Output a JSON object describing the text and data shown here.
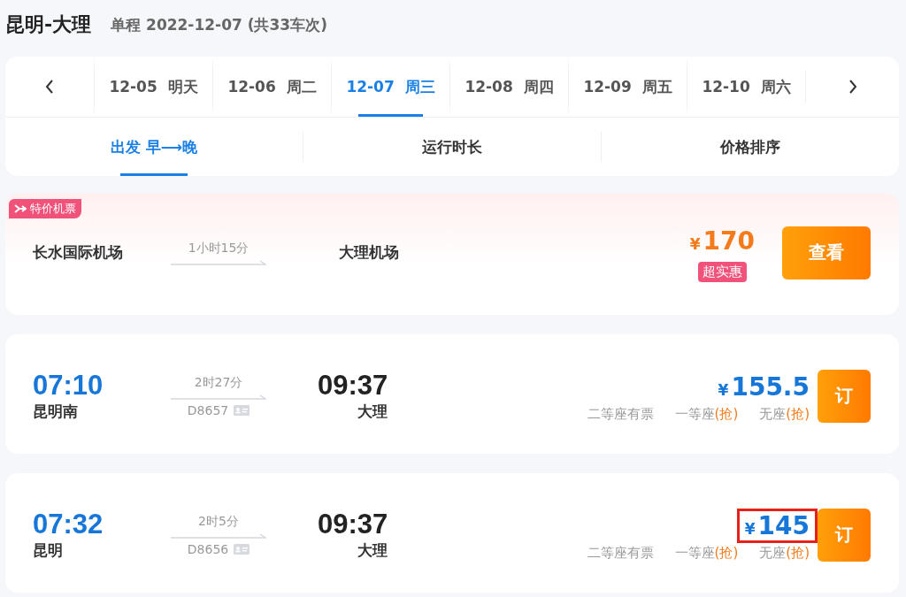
{
  "header": {
    "route": "昆明-大理",
    "summary": "单程 2022-12-07 (共33车次)"
  },
  "date_tabs": [
    {
      "date": "12-05",
      "day": "明天",
      "selected": false
    },
    {
      "date": "12-06",
      "day": "周二",
      "selected": false
    },
    {
      "date": "12-07",
      "day": "周三",
      "selected": true
    },
    {
      "date": "12-08",
      "day": "周四",
      "selected": false
    },
    {
      "date": "12-09",
      "day": "周五",
      "selected": false
    },
    {
      "date": "12-10",
      "day": "周六",
      "selected": false
    }
  ],
  "sort_tabs": [
    {
      "label": "出发 早⟶晚",
      "selected": true
    },
    {
      "label": "运行时长",
      "selected": false
    },
    {
      "label": "价格排序",
      "selected": false
    }
  ],
  "flight": {
    "badge": "特价机票",
    "from": "长水国际机场",
    "duration": "1小时15分",
    "to": "大理机场",
    "currency": "¥",
    "price": "170",
    "tag": "超实惠",
    "button": "查看"
  },
  "trains": [
    {
      "depart_time": "07:10",
      "depart_station": "昆明南",
      "duration": "2时27分",
      "number": "D8657",
      "arrive_time": "09:37",
      "arrive_station": "大理",
      "currency": "¥",
      "price": "155.5",
      "highlighted": false,
      "button": "订",
      "seats": [
        {
          "name": "二等座有票"
        },
        {
          "name": "一等座",
          "status": "(抢)"
        },
        {
          "name": "无座",
          "status": "(抢)"
        }
      ]
    },
    {
      "depart_time": "07:32",
      "depart_station": "昆明",
      "duration": "2时5分",
      "number": "D8656",
      "arrive_time": "09:37",
      "arrive_station": "大理",
      "currency": "¥",
      "price": "145",
      "highlighted": true,
      "button": "订",
      "seats": [
        {
          "name": "二等座有票"
        },
        {
          "name": "一等座",
          "status": "(抢)"
        },
        {
          "name": "无座",
          "status": "(抢)"
        }
      ]
    }
  ]
}
